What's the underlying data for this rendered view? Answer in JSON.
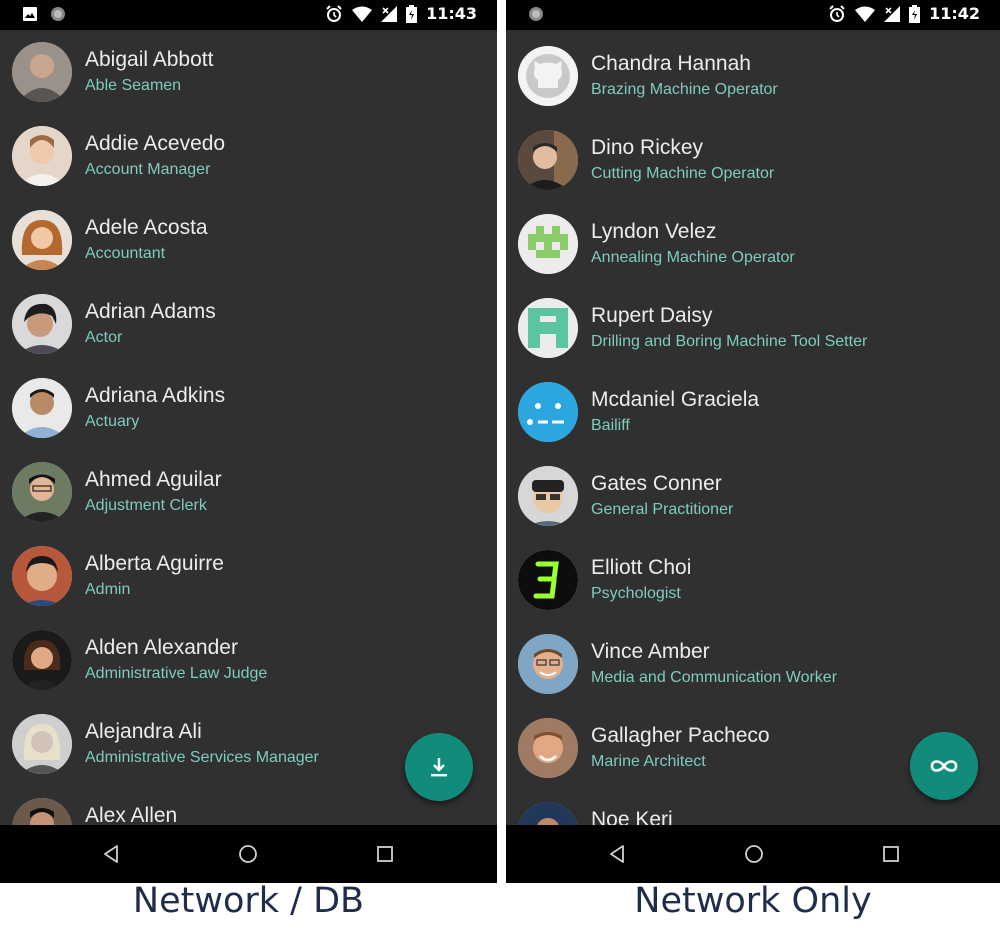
{
  "left_phone": {
    "status_time": "11:43",
    "caption": "Network / DB",
    "fab_icon": "download-icon",
    "contacts": [
      {
        "name": "Abigail Abbott",
        "role": "Able Seamen",
        "avatar_bg": "#8a7f76"
      },
      {
        "name": "Addie Acevedo",
        "role": "Account Manager",
        "avatar_bg": "#d8c3ae"
      },
      {
        "name": "Adele Acosta",
        "role": "Accountant",
        "avatar_bg": "#c7a27e"
      },
      {
        "name": "Adrian Adams",
        "role": "Actor",
        "avatar_bg": "#6c6a6c"
      },
      {
        "name": "Adriana Adkins",
        "role": "Actuary",
        "avatar_bg": "#a9b6c6"
      },
      {
        "name": "Ahmed Aguilar",
        "role": "Adjustment Clerk",
        "avatar_bg": "#5b6a58"
      },
      {
        "name": "Alberta Aguirre",
        "role": "Admin",
        "avatar_bg": "#9a6c52"
      },
      {
        "name": "Alden Alexander",
        "role": "Administrative Law Judge",
        "avatar_bg": "#3b3330"
      },
      {
        "name": "Alejandra Ali",
        "role": "Administrative Services Manager",
        "avatar_bg": "#bdbdbd"
      },
      {
        "name": "Alex Allen",
        "role": "",
        "avatar_bg": "#6b5a4c"
      }
    ]
  },
  "right_phone": {
    "status_time": "11:42",
    "caption": "Network Only",
    "fab_icon": "infinity-icon",
    "contacts": [
      {
        "name": "Chandra Hannah",
        "role": "Brazing Machine Operator",
        "avatar_kind": "github",
        "avatar_bg": "#f3f3f3"
      },
      {
        "name": "Dino Rickey",
        "role": "Cutting Machine Operator",
        "avatar_kind": "photo",
        "avatar_bg": "#4b4038"
      },
      {
        "name": "Lyndon Velez",
        "role": "Annealing Machine Operator",
        "avatar_kind": "pixel-green",
        "avatar_bg": "#8bcc6a"
      },
      {
        "name": "Rupert Daisy",
        "role": "Drilling and Boring Machine Tool Setter",
        "avatar_kind": "pixel-teal",
        "avatar_bg": "#5cc5a0"
      },
      {
        "name": "Mcdaniel Graciela",
        "role": "Bailiff",
        "avatar_kind": "dots",
        "avatar_bg": "#2ba6df"
      },
      {
        "name": "Gates Conner",
        "role": "General Practitioner",
        "avatar_kind": "cartoon",
        "avatar_bg": "#d7d7d7"
      },
      {
        "name": "Elliott Choi",
        "role": "Psychologist",
        "avatar_kind": "digit",
        "avatar_bg": "#0d0d0d"
      },
      {
        "name": "Vince Amber",
        "role": "Media and Communication Worker",
        "avatar_kind": "photo",
        "avatar_bg": "#7fa6c4"
      },
      {
        "name": "Gallagher Pacheco",
        "role": "Marine Architect",
        "avatar_kind": "photo",
        "avatar_bg": "#a07a62"
      },
      {
        "name": "Noe Keri",
        "role": "",
        "avatar_kind": "photo",
        "avatar_bg": "#22385a"
      }
    ]
  }
}
